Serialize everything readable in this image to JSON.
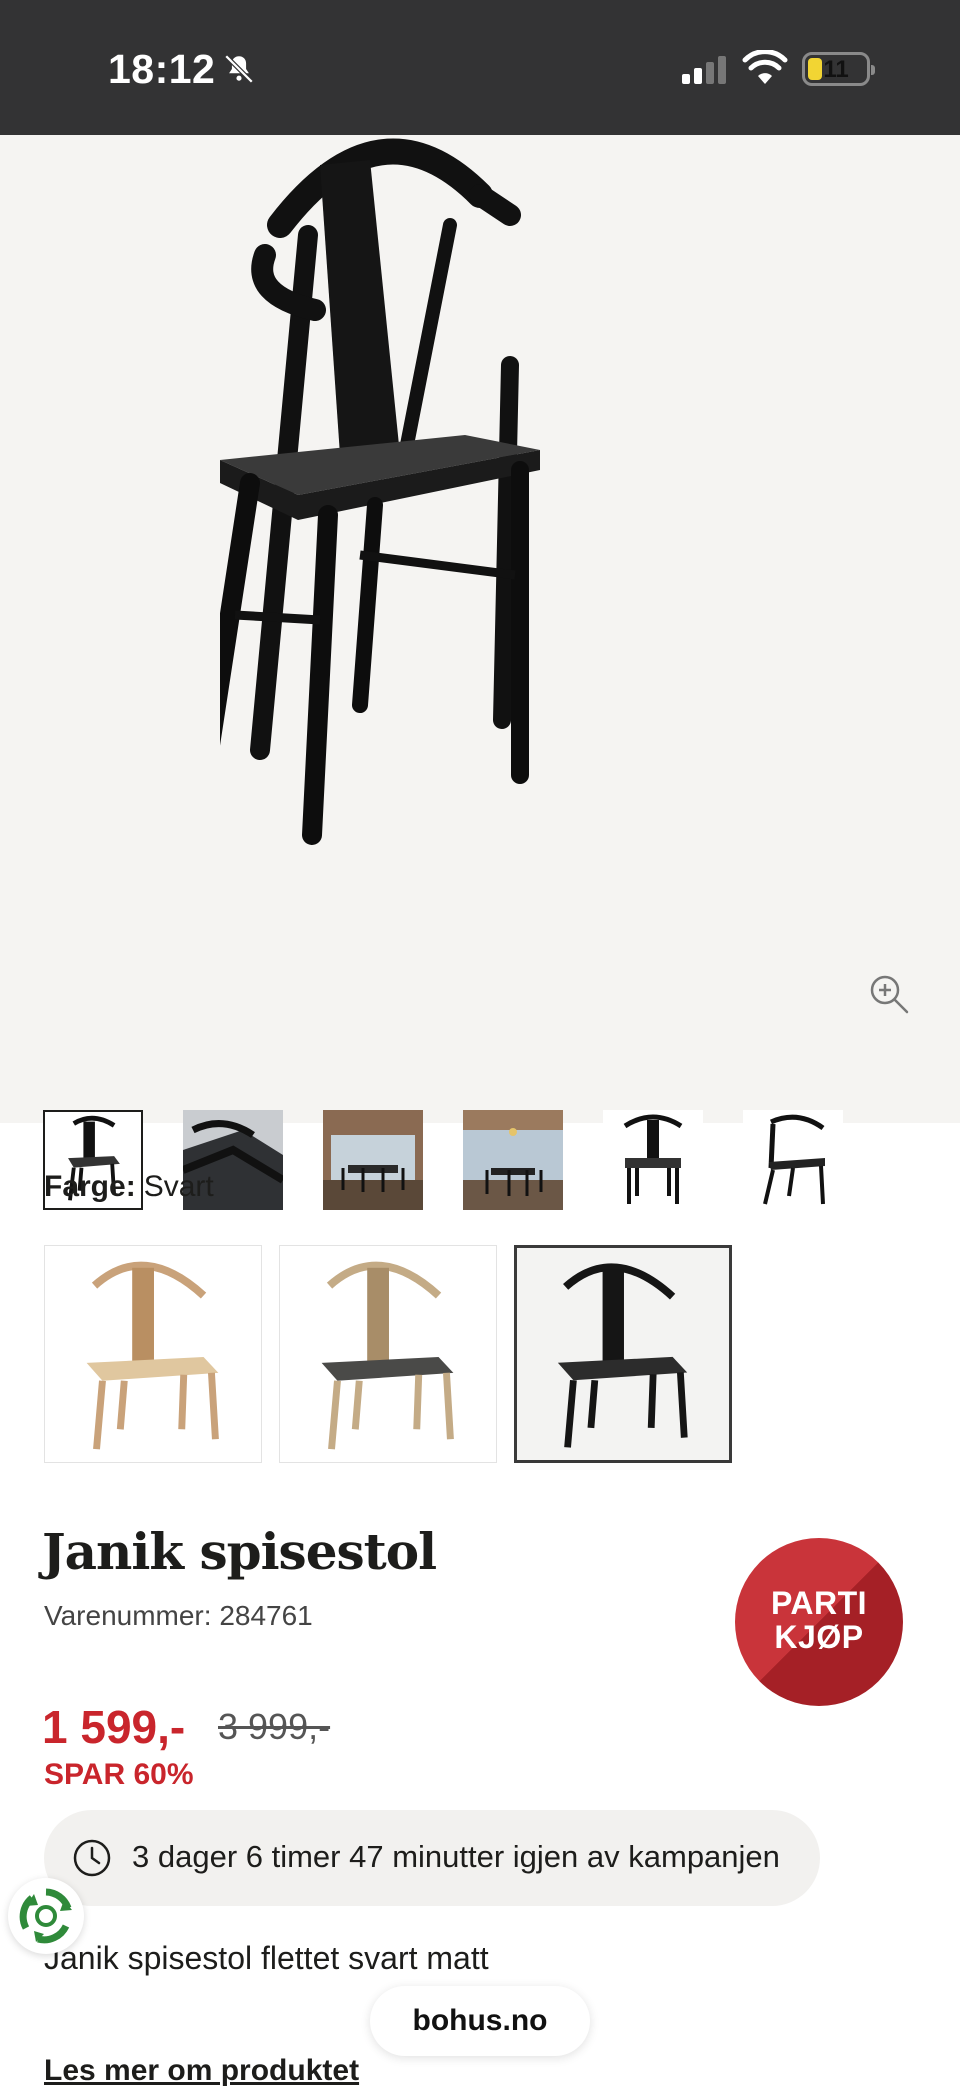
{
  "status_bar": {
    "time": "18:12",
    "battery": "11",
    "icons": [
      "bell-slash-icon",
      "signal-icon",
      "wifi-icon",
      "battery-icon"
    ]
  },
  "gallery": {
    "zoom_icon": "zoom-in-icon",
    "thumbnails": [
      {
        "name": "chair-front",
        "selected": true
      },
      {
        "name": "chair-closeup",
        "selected": false
      },
      {
        "name": "dining-room-interior",
        "selected": false
      },
      {
        "name": "dining-room-view",
        "selected": false
      },
      {
        "name": "chair-front-alt",
        "selected": false
      },
      {
        "name": "chair-side",
        "selected": false
      }
    ]
  },
  "color": {
    "label": "Farge:",
    "value": "Svart",
    "variants": [
      {
        "name": "natur",
        "selected": false,
        "frame": "#c9a27a",
        "seat": "#e0c79f"
      },
      {
        "name": "natur-gra",
        "selected": false,
        "frame": "#c4ab86",
        "seat": "#4a4a48"
      },
      {
        "name": "svart",
        "selected": true,
        "frame": "#151515",
        "seat": "#2c2c2c"
      }
    ]
  },
  "product": {
    "title": "Janik spisestol",
    "sku": "Varenummer: 284761",
    "badge": [
      "PARTI",
      "KJØP"
    ],
    "price": "1 599,-",
    "old_price": "3 999,-",
    "save": "SPAR 60%",
    "campaign": "3 dager 6 timer 47 minutter igjen av kampanjen",
    "description": "Janik spisestol flettet svart matt",
    "read_more": "Les mer om produktet"
  },
  "site_pill": "bohus.no",
  "colors": {
    "sale_red": "#c9252c",
    "badge_red": "#c9343a",
    "status_bar": "#333334",
    "gallery_bg": "#f5f4f2"
  }
}
